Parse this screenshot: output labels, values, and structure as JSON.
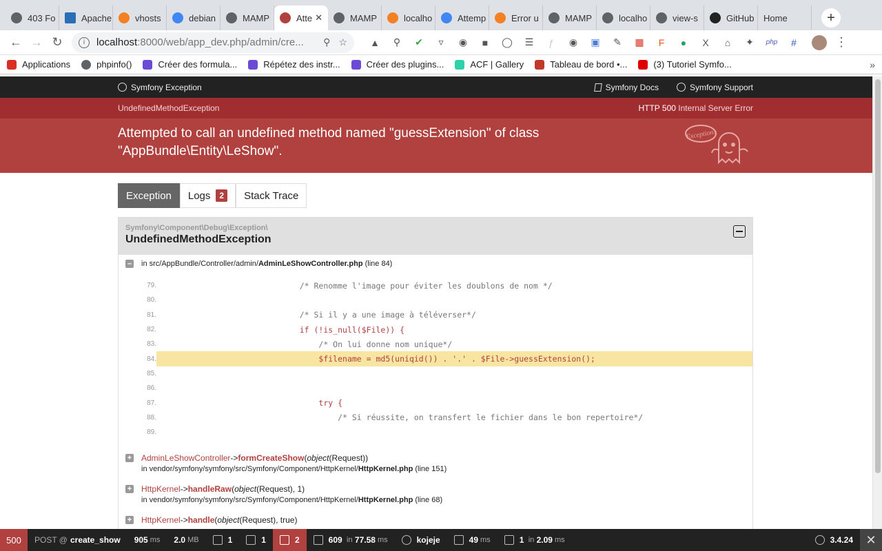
{
  "browser": {
    "tabs": [
      {
        "label": "403 Fo",
        "icon": "globe-icon"
      },
      {
        "label": "Apache",
        "icon": "df-icon"
      },
      {
        "label": "vhosts",
        "icon": "stackoverflow-icon"
      },
      {
        "label": "debian",
        "icon": "google-icon"
      },
      {
        "label": "MAMP",
        "icon": "mamp-icon"
      },
      {
        "label": "Atte",
        "icon": "symfony-ghost-icon"
      },
      {
        "label": "MAMP",
        "icon": "mamp-icon"
      },
      {
        "label": "localho",
        "icon": "phpmyadmin-icon"
      },
      {
        "label": "Attemp",
        "icon": "google-icon"
      },
      {
        "label": "Error u",
        "icon": "stackoverflow-icon"
      },
      {
        "label": "MAMP",
        "icon": "mamp-icon"
      },
      {
        "label": "localho",
        "icon": "mamp-icon"
      },
      {
        "label": "view-s",
        "icon": "mamp-icon"
      },
      {
        "label": "GitHub",
        "icon": "github-icon"
      },
      {
        "label": "Home",
        "icon": ""
      }
    ],
    "active_tab_index": 5,
    "url_host": "localhost",
    "url_rest": ":8000/web/app_dev.php/admin/cre...",
    "bookmarks": [
      {
        "label": "Applications",
        "color": "#d93025"
      },
      {
        "label": "phpinfo()",
        "color": "#5f6368"
      },
      {
        "label": "Créer des formula...",
        "color": "#6c4ad8"
      },
      {
        "label": "Répétez des instr...",
        "color": "#6c4ad8"
      },
      {
        "label": "Créer des plugins...",
        "color": "#6c4ad8"
      },
      {
        "label": "ACF | Gallery",
        "color": "#2fd1a9"
      },
      {
        "label": "Tableau de bord •...",
        "color": "#c0392b"
      },
      {
        "label": "(3) Tutoriel Symfo...",
        "color": "#e00000"
      }
    ]
  },
  "symfony": {
    "top_brand": "Symfony Exception",
    "docs_link": "Symfony Docs",
    "support_link": "Symfony Support",
    "exception_short": "UndefinedMethodException",
    "http_code": "HTTP 500",
    "http_text": "Internal Server Error",
    "message": "Attempted to call an undefined method named \"guessExtension\" of class \"AppBundle\\Entity\\LeShow\".",
    "tabs": {
      "exception": "Exception",
      "logs": "Logs",
      "logs_count": "2",
      "stack": "Stack Trace"
    },
    "trace": {
      "namespace": "Symfony\\Component\\Debug\\Exception\\",
      "class": "UndefinedMethodException",
      "file_prefix": "in src/AppBundle/Controller/admin/",
      "file_name": "AdminLeShowController.php",
      "file_line": "(line 84)"
    },
    "code_lines": [
      {
        "n": "79.",
        "indent": "                        ",
        "text": "/* Renomme l'image pour éviter les doublons de nom */",
        "cls": "cm"
      },
      {
        "n": "80.",
        "indent": "",
        "text": "",
        "cls": ""
      },
      {
        "n": "81.",
        "indent": "                        ",
        "text": "/* Si il y a une image à téléverser*/",
        "cls": "cm"
      },
      {
        "n": "82.",
        "indent": "                        ",
        "text": "if (!is_null($File)) {",
        "cls": "kw"
      },
      {
        "n": "83.",
        "indent": "                            ",
        "text": "/* On lui donne nom unique*/",
        "cls": "cm"
      },
      {
        "n": "84.",
        "indent": "                            ",
        "text": "$filename = md5(uniqid()) . '.' . $File->guessExtension();",
        "cls": "var"
      },
      {
        "n": "85.",
        "indent": "",
        "text": "",
        "cls": ""
      },
      {
        "n": "86.",
        "indent": "",
        "text": "",
        "cls": ""
      },
      {
        "n": "87.",
        "indent": "                            ",
        "text": "try {",
        "cls": "kw"
      },
      {
        "n": "88.",
        "indent": "                                ",
        "text": "/* Si réussite, on transfert le fichier dans le bon repertoire*/",
        "cls": "cm"
      },
      {
        "n": "89.",
        "indent": "",
        "text": "",
        "cls": ""
      }
    ],
    "frames": [
      {
        "cls": "AdminLeShowController",
        "arrow": "->",
        "method": "formCreateShow",
        "arg_type": "object",
        "args": "(Request))",
        "loc_prefix": "in vendor/symfony/symfony/src/Symfony/Component/HttpKernel/",
        "loc_file": "HttpKernel.php",
        "loc_line": "(line 151)"
      },
      {
        "cls": "HttpKernel",
        "arrow": "->",
        "method": "handleRaw",
        "arg_type": "object",
        "args": "(Request), 1)",
        "loc_prefix": "in vendor/symfony/symfony/src/Symfony/Component/HttpKernel/",
        "loc_file": "HttpKernel.php",
        "loc_line": "(line 68)"
      },
      {
        "cls": "HttpKernel",
        "arrow": "->",
        "method": "handle",
        "arg_type": "object",
        "args": "(Request), true)",
        "loc_prefix": "",
        "loc_file": "",
        "loc_line": ""
      }
    ]
  },
  "profiler": {
    "status": "500",
    "method": "POST @",
    "route": "create_show",
    "time": "905",
    "time_unit": "ms",
    "memory": "2.0",
    "memory_unit": "MB",
    "forms": "1",
    "logs": "1",
    "errors": "2",
    "twig_count": "609",
    "twig_in": "in",
    "twig_time": "77.58",
    "twig_unit": "ms",
    "user": "kojeje",
    "cache_time": "49",
    "cache_unit": "ms",
    "db_queries": "1",
    "db_in": "in",
    "db_time": "2.09",
    "db_unit": "ms",
    "version": "3.4.24"
  }
}
